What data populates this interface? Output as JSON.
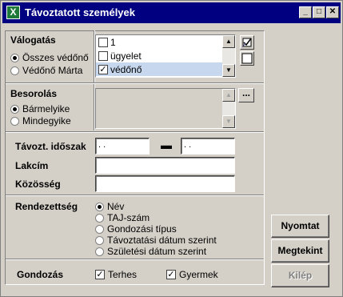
{
  "window": {
    "title": "Távoztatott személyek",
    "icon": "excel-icon",
    "controls": [
      "minimize",
      "maximize",
      "close"
    ]
  },
  "valogatas": {
    "label": "Válogatás",
    "radios": [
      {
        "label": "Összes védőnő",
        "selected": true
      },
      {
        "label": "Védőnő Márta",
        "selected": false
      }
    ],
    "list": [
      {
        "label": "1",
        "checked": false
      },
      {
        "label": "ügyelet",
        "checked": false
      },
      {
        "label": "védőnő",
        "checked": true
      }
    ]
  },
  "besorolas": {
    "label": "Besorolás",
    "radios": [
      {
        "label": "Bármelyike",
        "selected": true
      },
      {
        "label": "Mindegyike",
        "selected": false
      }
    ],
    "browse_label": "..."
  },
  "tavozt": {
    "label": "Távozt. időszak",
    "from_value": "  .  .",
    "to_value": "  .  ."
  },
  "lakcim": {
    "label": "Lakcím",
    "value": ""
  },
  "kozosseg": {
    "label": "Közösség",
    "value": ""
  },
  "rendezettseg": {
    "label": "Rendezettség",
    "options": [
      {
        "label": "Név",
        "selected": true
      },
      {
        "label": "TAJ-szám",
        "selected": false
      },
      {
        "label": "Gondozási típus",
        "selected": false
      },
      {
        "label": "Távoztatási dátum szerint",
        "selected": false
      },
      {
        "label": "Születési dátum szerint",
        "selected": false
      }
    ]
  },
  "gondozas": {
    "label": "Gondozás",
    "checks": [
      {
        "label": "Terhes",
        "checked": true
      },
      {
        "label": "Gyermek",
        "checked": true
      }
    ]
  },
  "buttons": {
    "nyomtat": "Nyomtat",
    "megtekint": "Megtekint",
    "kilep": "Kilép"
  },
  "glyphs": {
    "min": "_",
    "max": "□",
    "close": "✕",
    "check": "✓",
    "up": "▲",
    "down": "▼",
    "dash": "▬",
    "x": "X"
  }
}
